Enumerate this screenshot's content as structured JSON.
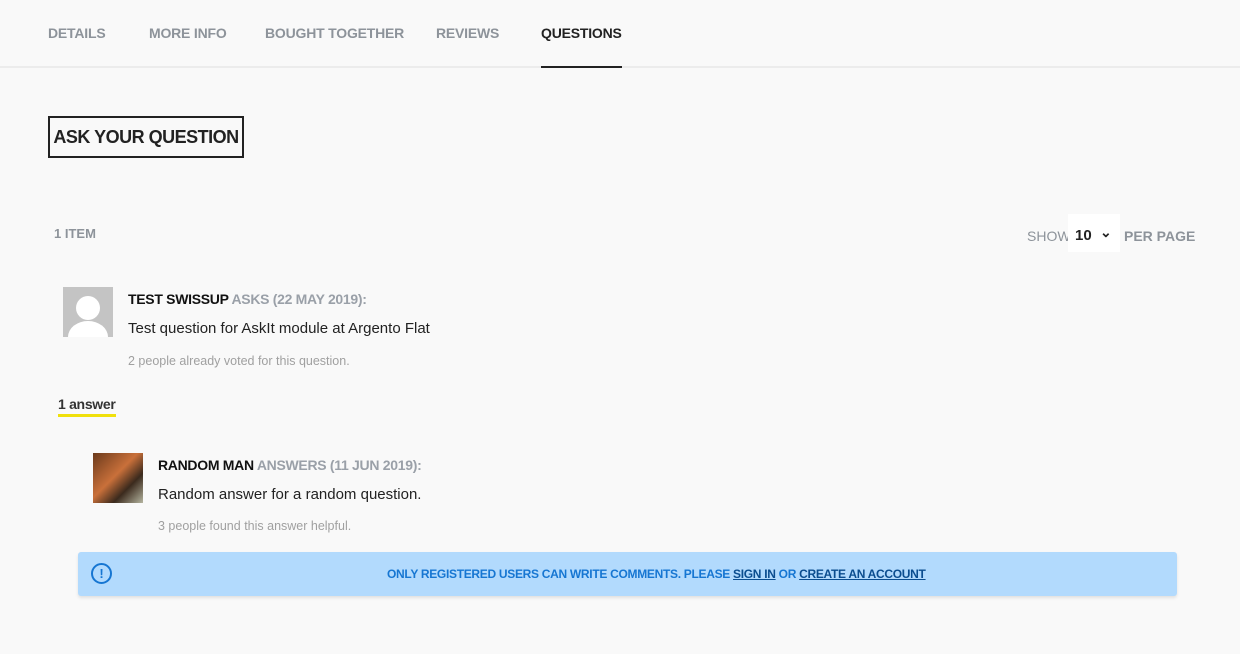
{
  "tabs": [
    {
      "label": "DETAILS"
    },
    {
      "label": "MORE INFO"
    },
    {
      "label": "BOUGHT TOGETHER"
    },
    {
      "label": "REVIEWS"
    },
    {
      "label": "QUESTIONS",
      "active": true
    }
  ],
  "ask_button": "ASK YOUR QUESTION",
  "toolbar": {
    "count": "1 ITEM",
    "show": "SHOW",
    "per_page_value": "10",
    "per_page": "PER PAGE"
  },
  "question": {
    "author": "TEST SWISSUP",
    "action": "ASKS (22 MAY 2019):",
    "text": "Test question for AskIt module at Argento Flat",
    "votes": "2 people already voted for this question."
  },
  "answers_label": "1 answer",
  "answer": {
    "author": "RANDOM MAN",
    "action": "ANSWERS (11 JUN 2019):",
    "text": "Random answer for a random question.",
    "helpful": "3 people found this answer helpful."
  },
  "notice": {
    "text": "ONLY REGISTERED USERS CAN WRITE COMMENTS. PLEASE",
    "sign_in": "SIGN IN",
    "or": "OR",
    "create": "CREATE AN ACCOUNT"
  },
  "colors": {
    "notice_bg": "#b2dafd",
    "notice_text": "#1676d2",
    "underline": "#f0e00c"
  }
}
